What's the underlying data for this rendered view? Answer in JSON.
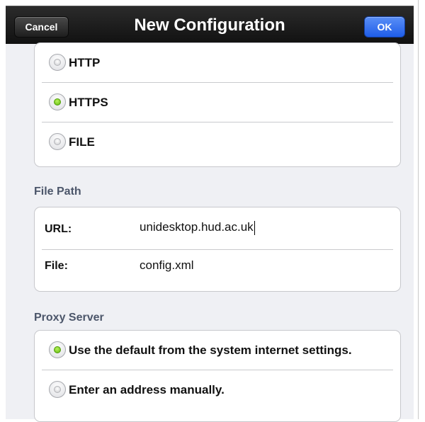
{
  "navbar": {
    "title": "New Configuration",
    "cancel_label": "Cancel",
    "ok_label": "OK"
  },
  "protocol": {
    "options": [
      {
        "label": "HTTP",
        "selected": false
      },
      {
        "label": "HTTPS",
        "selected": true
      },
      {
        "label": "FILE",
        "selected": false
      }
    ]
  },
  "file_path": {
    "section_title": "File Path",
    "url_label": "URL:",
    "url_value": "unidesktop.hud.ac.uk",
    "file_label": "File:",
    "file_value": "config.xml"
  },
  "proxy": {
    "section_title": "Proxy Server",
    "options": [
      {
        "label": "Use the default from the system internet settings.",
        "selected": true
      },
      {
        "label": "Enter an address manually.",
        "selected": false
      }
    ]
  },
  "colors": {
    "selected_radio": "#6cc313",
    "ok_button": "#2d6bef",
    "section_title": "#4c566a"
  }
}
